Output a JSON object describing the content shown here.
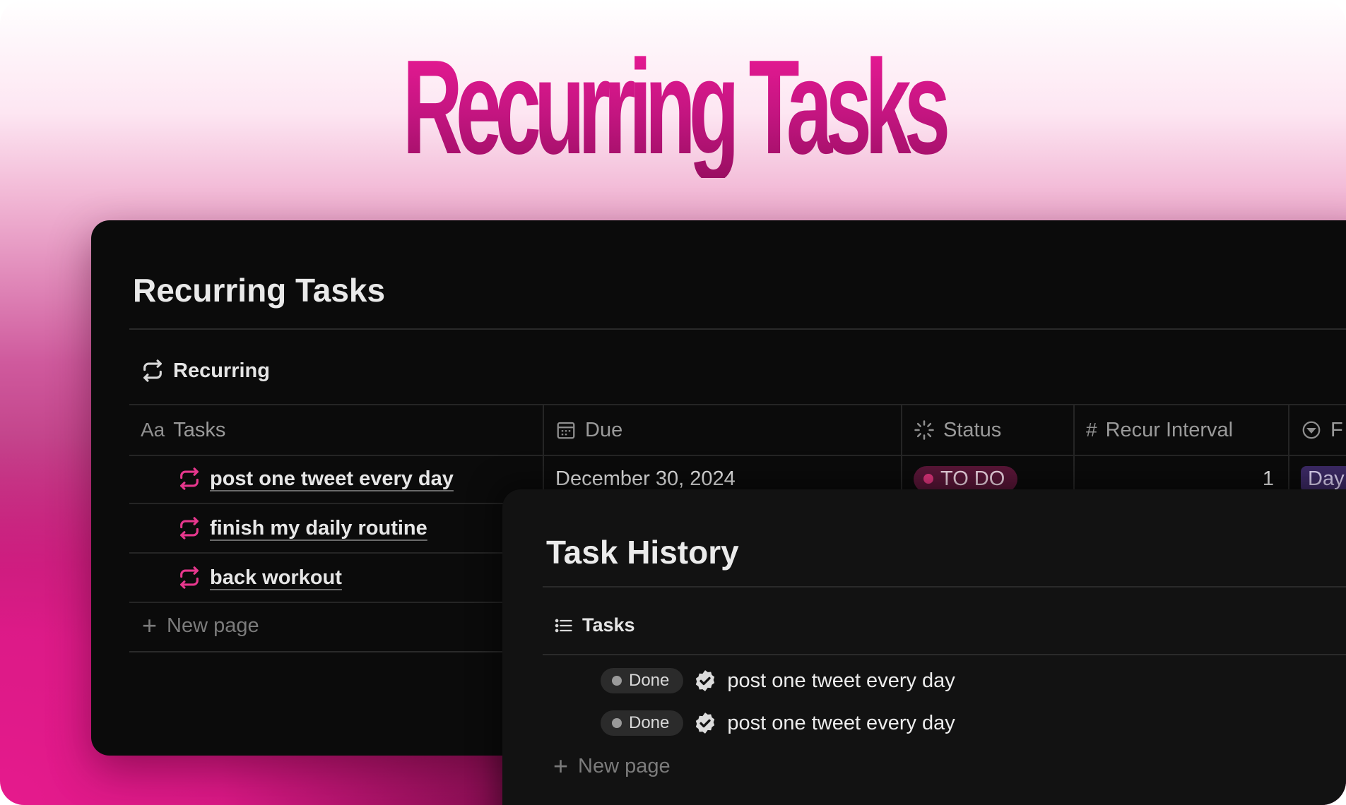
{
  "hero": {
    "title": "Recurring Tasks"
  },
  "main": {
    "title": "Recurring Tasks",
    "view_tab": {
      "label": "Recurring",
      "icon": "repeat-icon"
    },
    "columns": [
      {
        "label": "Tasks",
        "prefix": "Aa"
      },
      {
        "label": "Due",
        "icon": "calendar-icon"
      },
      {
        "label": "Status",
        "icon": "status-spinner-icon"
      },
      {
        "label": "Recur Interval",
        "prefix": "#"
      },
      {
        "label": "F",
        "icon": "select-icon"
      }
    ],
    "rows": [
      {
        "task": "post one tweet every day",
        "due": "December 30, 2024",
        "status": "TO DO",
        "interval": "1",
        "tag": "Day"
      },
      {
        "task": "finish my daily routine"
      },
      {
        "task": "back workout"
      }
    ],
    "new_page": "New page"
  },
  "history": {
    "title": "Task History",
    "view_tab": {
      "label": "Tasks",
      "icon": "list-icon"
    },
    "items": [
      {
        "status": "Done",
        "task": "post one tweet every day"
      },
      {
        "status": "Done",
        "task": "post one tweet every day"
      }
    ],
    "new_page": "New page"
  },
  "colors": {
    "accent_pink": "#e61a8d",
    "panel_bg": "#0b0b0b",
    "status_todo_bg": "#5a1638",
    "tag_day_bg": "#3d2a66"
  }
}
